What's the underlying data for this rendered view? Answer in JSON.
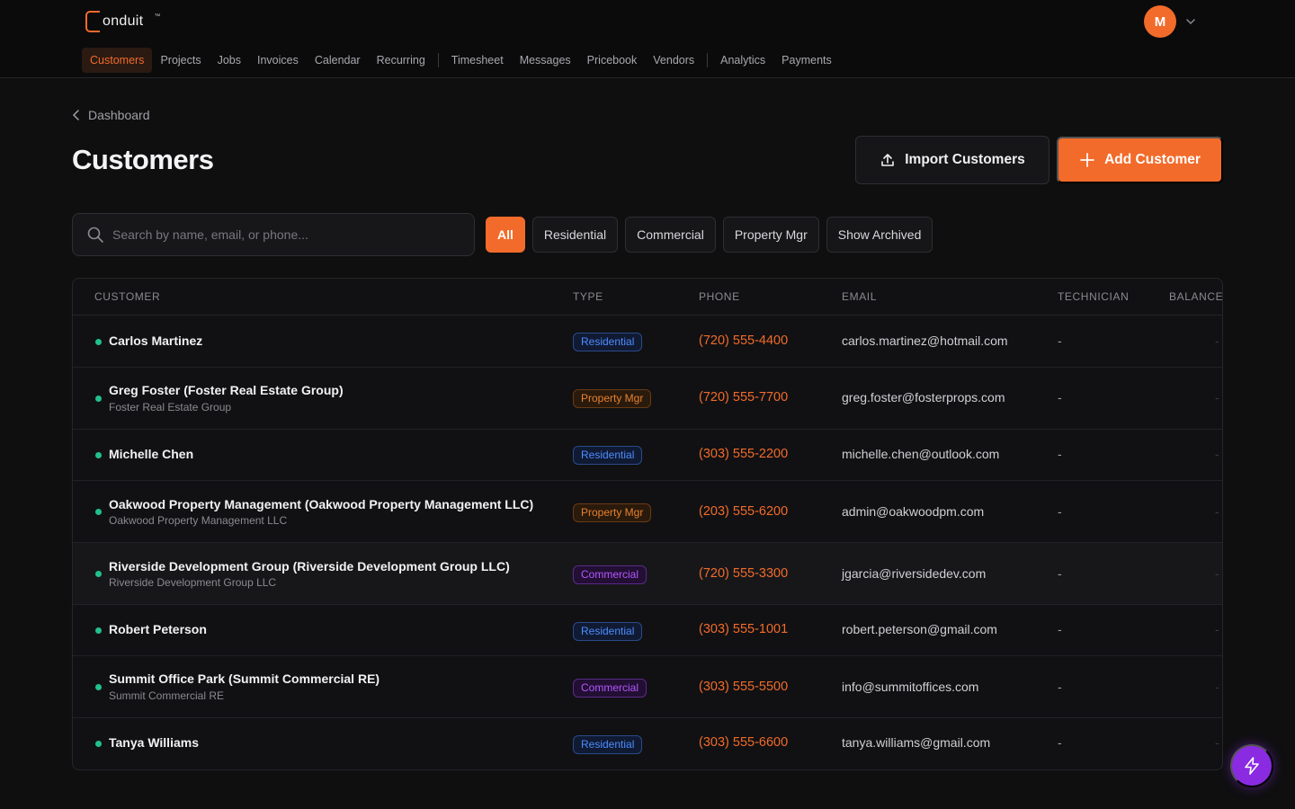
{
  "app": {
    "logo_text": "onduit",
    "logo_tm": "™",
    "avatar_initial": "M"
  },
  "nav": [
    {
      "label": "Customers",
      "active": true
    },
    {
      "label": "Projects"
    },
    {
      "label": "Jobs"
    },
    {
      "label": "Invoices"
    },
    {
      "label": "Calendar"
    },
    {
      "label": "Recurring"
    },
    {
      "label": "Timesheet"
    },
    {
      "label": "Messages"
    },
    {
      "label": "Pricebook"
    },
    {
      "label": "Vendors"
    },
    {
      "label": "Analytics"
    },
    {
      "label": "Payments"
    }
  ],
  "breadcrumb": {
    "label": "Dashboard"
  },
  "page": {
    "title": "Customers",
    "import_label": "Import Customers",
    "add_label": "Add Customer"
  },
  "search": {
    "placeholder": "Search by name, email, or phone..."
  },
  "filters": [
    "All",
    "Residential",
    "Commercial",
    "Property Mgr",
    "Show Archived"
  ],
  "table": {
    "columns": [
      "CUSTOMER",
      "TYPE",
      "PHONE",
      "EMAIL",
      "TECHNICIAN",
      "BALANCE"
    ],
    "rows": [
      {
        "name": "Carlos Martinez",
        "sub": "",
        "type": "Residential",
        "phone": "(720) 555-4400",
        "email": "carlos.martinez@hotmail.com",
        "tech": "-",
        "balance": "-"
      },
      {
        "name": "Greg Foster (Foster Real Estate Group)",
        "sub": "Foster Real Estate Group",
        "type": "Property Mgr",
        "phone": "(720) 555-7700",
        "email": "greg.foster@fosterprops.com",
        "tech": "-",
        "balance": "-"
      },
      {
        "name": "Michelle Chen",
        "sub": "",
        "type": "Residential",
        "phone": "(303) 555-2200",
        "email": "michelle.chen@outlook.com",
        "tech": "-",
        "balance": "-"
      },
      {
        "name": "Oakwood Property Management (Oakwood Property Management LLC)",
        "sub": "Oakwood Property Management LLC",
        "type": "Property Mgr",
        "phone": "(203) 555-6200",
        "email": "admin@oakwoodpm.com",
        "tech": "-",
        "balance": "-"
      },
      {
        "name": "Riverside Development Group (Riverside Development Group LLC)",
        "sub": "Riverside Development Group LLC",
        "type": "Commercial",
        "phone": "(720) 555-3300",
        "email": "jgarcia@riversidedev.com",
        "tech": "-",
        "balance": "-"
      },
      {
        "name": "Robert Peterson",
        "sub": "",
        "type": "Residential",
        "phone": "(303) 555-1001",
        "email": "robert.peterson@gmail.com",
        "tech": "-",
        "balance": "-"
      },
      {
        "name": "Summit Office Park (Summit Commercial RE)",
        "sub": "Summit Commercial RE",
        "type": "Commercial",
        "phone": "(303) 555-5500",
        "email": "info@summitoffices.com",
        "tech": "-",
        "balance": "-"
      },
      {
        "name": "Tanya Williams",
        "sub": "",
        "type": "Residential",
        "phone": "(303) 555-6600",
        "email": "tanya.williams@gmail.com",
        "tech": "-",
        "balance": "-"
      }
    ]
  },
  "colors": {
    "accent": "#f26b2a",
    "status_active": "#22c08a",
    "fab": "#8a2be2"
  }
}
